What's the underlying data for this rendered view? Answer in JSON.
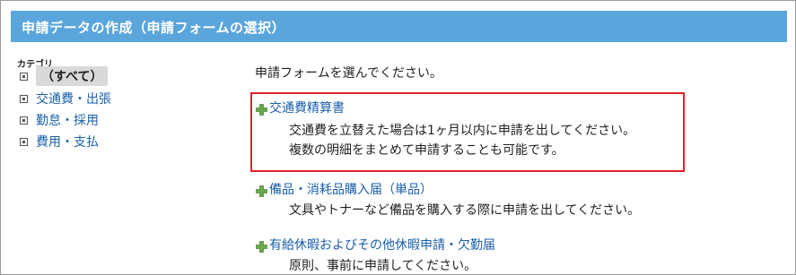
{
  "header": {
    "title": "申請データの作成（申請フォームの選択）"
  },
  "categories": {
    "heading": "カテゴリ",
    "items": [
      {
        "label": "（すべて）",
        "selected": true
      },
      {
        "label": "交通費・出張",
        "selected": false
      },
      {
        "label": "勤怠・採用",
        "selected": false
      },
      {
        "label": "費用・支払",
        "selected": false
      }
    ]
  },
  "main": {
    "instruction": "申請フォームを選んでください。",
    "forms": [
      {
        "title": "交通費精算書",
        "description": [
          "交通費を立替えた場合は1ヶ月以内に申請を出してください。",
          "複数の明細をまとめて申請することも可能です。"
        ]
      },
      {
        "title": "備品・消耗品購入届（単品）",
        "description": [
          "文具やトナーなど備品を購入する際に申請を出してください。"
        ]
      },
      {
        "title": "有給休暇およびその他休暇申請・欠勤届",
        "description": [
          "原則、事前に申請してください。"
        ]
      }
    ]
  },
  "colors": {
    "header": "#5aa6dc",
    "link": "#1a5fa8",
    "highlight": "#e3212b",
    "plus": "#6aa84f"
  }
}
